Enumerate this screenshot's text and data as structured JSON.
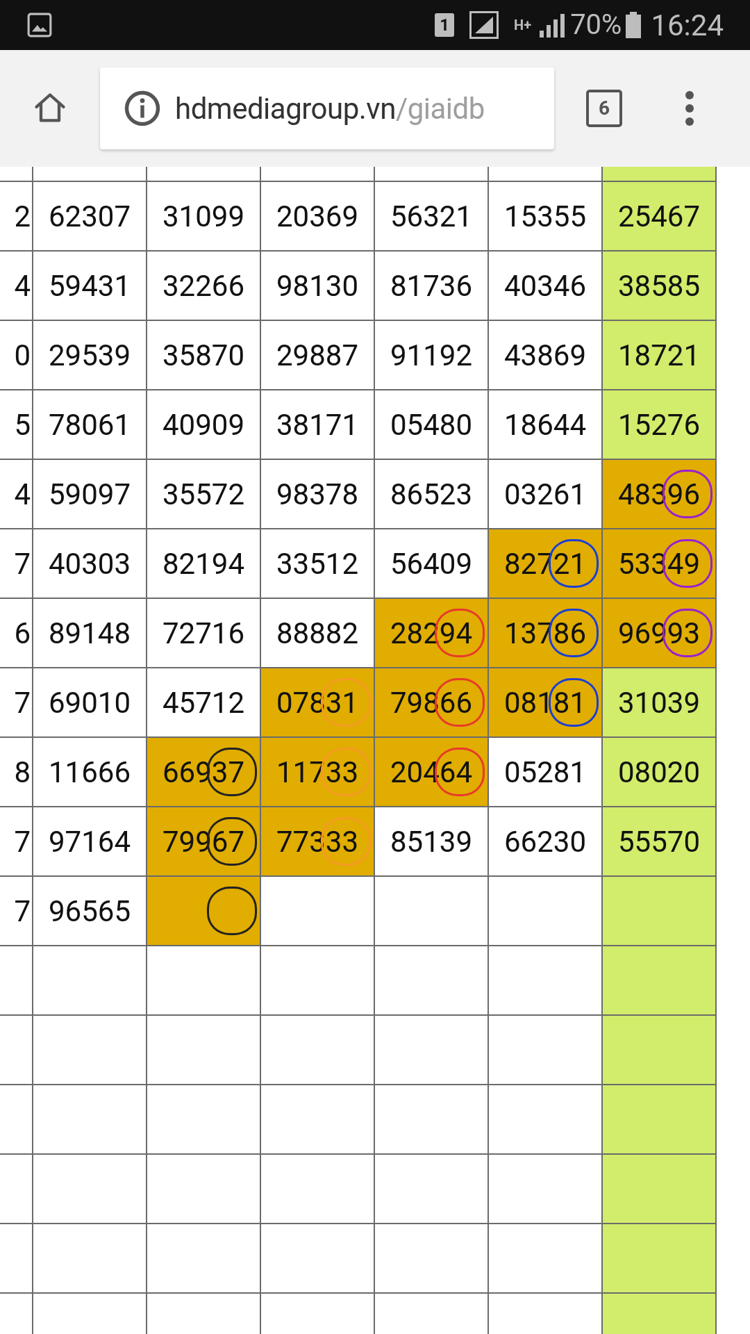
{
  "status_bar": {
    "sim": "1",
    "network": "H+",
    "battery": "70%",
    "time": "16:24"
  },
  "browser": {
    "url_host": "hdmediagroup.vn",
    "url_path": "/giaidb",
    "tab_count": "6"
  },
  "table": {
    "columns": [
      {
        "kind": "plain"
      },
      {
        "kind": "plain"
      },
      {
        "kind": "plain"
      },
      {
        "kind": "plain"
      },
      {
        "kind": "plain"
      },
      {
        "kind": "green"
      }
    ],
    "rows": [
      {
        "lead": "2",
        "cells": [
          {
            "text": "62307"
          },
          {
            "text": "31099"
          },
          {
            "text": "20369"
          },
          {
            "text": "56321"
          },
          {
            "text": "15355"
          },
          {
            "text": "25467"
          }
        ]
      },
      {
        "lead": "4",
        "cells": [
          {
            "text": "59431"
          },
          {
            "text": "32266"
          },
          {
            "text": "98130"
          },
          {
            "text": "81736"
          },
          {
            "text": "40346"
          },
          {
            "text": "38585"
          }
        ]
      },
      {
        "lead": "0",
        "cells": [
          {
            "text": "29539"
          },
          {
            "text": "35870"
          },
          {
            "text": "29887"
          },
          {
            "text": "91192"
          },
          {
            "text": "43869"
          },
          {
            "text": "18721"
          }
        ]
      },
      {
        "lead": "5",
        "cells": [
          {
            "text": "78061"
          },
          {
            "text": "40909"
          },
          {
            "text": "38171"
          },
          {
            "text": "05480"
          },
          {
            "text": "18644"
          },
          {
            "text": "15276"
          }
        ]
      },
      {
        "lead": "4",
        "cells": [
          {
            "text": "59097"
          },
          {
            "text": "35572"
          },
          {
            "text": "98378"
          },
          {
            "text": "86523"
          },
          {
            "text": "03261"
          },
          {
            "text": "48396",
            "highlighted": true,
            "color": "#9b1fd0"
          }
        ]
      },
      {
        "lead": "7",
        "cells": [
          {
            "text": "40303"
          },
          {
            "text": "82194"
          },
          {
            "text": "33512"
          },
          {
            "text": "56409"
          },
          {
            "text": "82721",
            "highlighted": true,
            "color": "#1a3fd6"
          },
          {
            "text": "53349",
            "highlighted": true,
            "color": "#9b1fd0"
          }
        ]
      },
      {
        "lead": "6",
        "cells": [
          {
            "text": "89148"
          },
          {
            "text": "72716"
          },
          {
            "text": "88882"
          },
          {
            "text": "28294",
            "highlighted": true,
            "color": "#e8392b"
          },
          {
            "text": "13786",
            "highlighted": true,
            "color": "#1a3fd6"
          },
          {
            "text": "96993",
            "highlighted": true,
            "color": "#9b1fd0"
          }
        ]
      },
      {
        "lead": "7",
        "cells": [
          {
            "text": "69010"
          },
          {
            "text": "45712"
          },
          {
            "text": "07831",
            "highlighted": true,
            "color": "#f59a23"
          },
          {
            "text": "79866",
            "highlighted": true,
            "color": "#e8392b"
          },
          {
            "text": "08181",
            "highlighted": true,
            "color": "#1a3fd6"
          },
          {
            "text": "31039"
          }
        ]
      },
      {
        "lead": "8",
        "cells": [
          {
            "text": "11666"
          },
          {
            "text": "66937",
            "highlighted": true,
            "color": "#222222"
          },
          {
            "text": "11733",
            "highlighted": true,
            "color": "#f59a23"
          },
          {
            "text": "20464",
            "highlighted": true,
            "color": "#e8392b"
          },
          {
            "text": "05281"
          },
          {
            "text": "08020"
          }
        ]
      },
      {
        "lead": "7",
        "cells": [
          {
            "text": "97164"
          },
          {
            "text": "79967",
            "highlighted": true,
            "color": "#222222"
          },
          {
            "text": "77333",
            "highlighted": true,
            "color": "#f59a23"
          },
          {
            "text": "85139"
          },
          {
            "text": "66230"
          },
          {
            "text": "55570"
          }
        ]
      },
      {
        "lead": "7",
        "cells": [
          {
            "text": "96565"
          },
          {
            "highlighted": true,
            "color": "#222222"
          },
          {},
          {},
          {},
          {}
        ]
      }
    ]
  }
}
